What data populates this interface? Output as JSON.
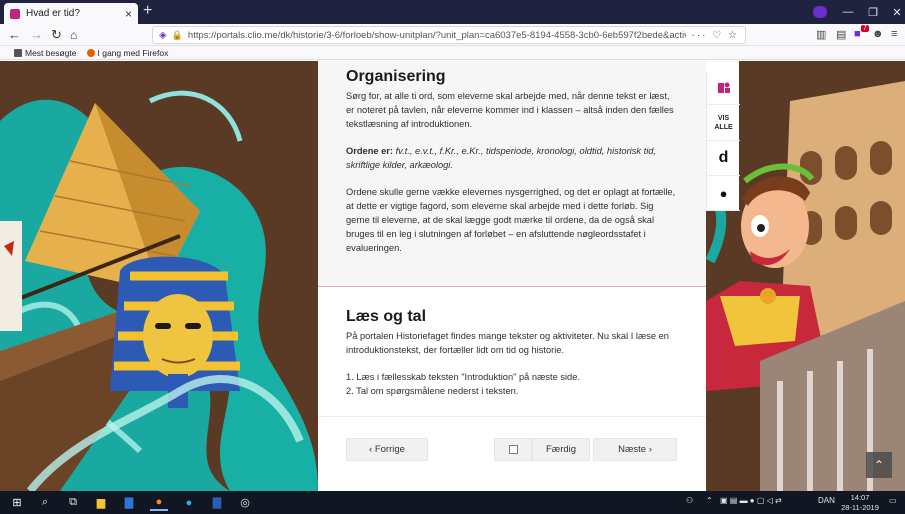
{
  "browser": {
    "tab_title": "Hvad er tid?",
    "tab_close": "×",
    "new_tab": "+",
    "url": "https://portals.clio.me/dk/historie/3-6/forloeb/show-unitplan/?unit_plan=ca6037e5-8194-4558-3cb0-6eb597f2bede&active_elem",
    "url_actions": "··· ♡ ☆",
    "bookmarks": [
      "Mest besøgte",
      "I gang med Firefox"
    ],
    "window_controls": [
      "—",
      "❐",
      "✕"
    ],
    "notification_badge": "7"
  },
  "section_organisering": {
    "heading": "Organisering",
    "para1": "Sørg for, at alle ti ord, som eleverne skal arbejde med, når denne tekst er læst, er noteret på tavlen, når eleverne kommer ind i klassen – altså inden den fælles tekstlæsning af introduktionen.",
    "ordene_label": "Ordene er:",
    "ordene_list": " fv.t., e.v.t., f.Kr., e.Kr., tidsperiode, kronologi, oldtid, historisk tid, skriftlige kilder, arkæologi.",
    "para3": "Ordene skulle gerne vække elevernes nysgerrighed, og det er oplagt at fortælle, at dette er vigtige fagord, som eleverne skal arbejde med i dette forløb. Sig gerne til eleverne, at de skal lægge godt mærke til ordene, da de også skal bruges til en leg i slutningen af forløbet – en afsluttende nøgleordsstafet i evalueringen."
  },
  "section_laes": {
    "heading": "Læs og tal",
    "para1": "På portalen Historiefaget findes mange tekster og aktiviteter. Nu skal I læse en introduktionstekst, der fortæller lidt om tid og historie.",
    "step1": "1. Læs i fællesskab teksten \"Introduktion\" på næste side.",
    "step2": "2. Tal om spørgsmålene nederst i teksten."
  },
  "nav": {
    "prev": "‹  Forrige",
    "done": "Færdig",
    "next": "Næste  ›"
  },
  "sidebar": {
    "vis_alle_line1": "VIS",
    "vis_alle_line2": "ALLE",
    "letter_d": "d"
  },
  "taskbar": {
    "language": "DAN",
    "time": "14:07",
    "date": "28-11-2019"
  },
  "colors": {
    "accent_pink": "#c0247d",
    "divider_pink": "#e9a1c7",
    "tabbar": "#202340",
    "taskbar": "#111722"
  }
}
